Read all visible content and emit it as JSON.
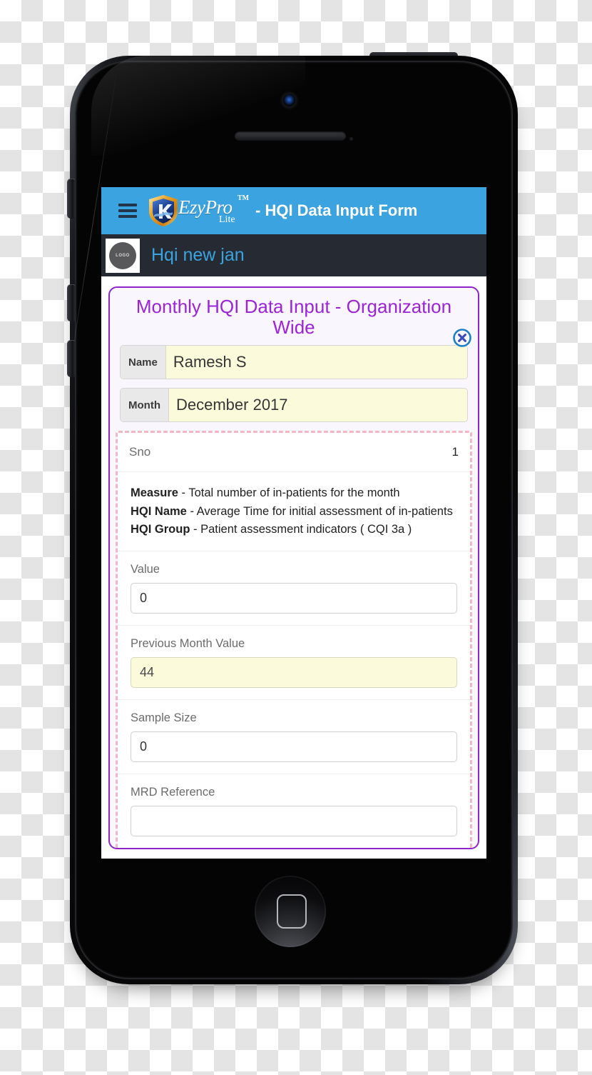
{
  "app": {
    "header": {
      "menu_icon": "hamburger-menu-icon",
      "brand_name": "EzyPro",
      "brand_tm": "TM",
      "brand_edition": "Lite",
      "title": "- HQI Data Input Form",
      "background_color": "#3ba3e0"
    },
    "sub_header": {
      "logo_text": "LOGO",
      "org_name": "Hqi new jan",
      "background_color": "#262a33",
      "org_name_color": "#3ba3e0"
    }
  },
  "form": {
    "title": "Monthly HQI Data Input - Organization Wide",
    "title_color": "#9b23d8",
    "border_color": "#8e24c9",
    "close_icon": "close-circle-icon",
    "fields": [
      {
        "label": "Name",
        "value": "Ramesh S"
      },
      {
        "label": "Month",
        "value": "December 2017"
      }
    ],
    "record": {
      "sno_label": "Sno",
      "sno_value": "1",
      "measure_label": "Measure",
      "measure_text": "- Total number of in-patients for the month",
      "hqi_name_label": "HQI Name",
      "hqi_name_text": "- Average Time for initial assessment of in-patients",
      "hqi_group_label": "HQI Group",
      "hqi_group_text": "- Patient assessment indicators ( CQI 3a )",
      "inputs": [
        {
          "label": "Value",
          "value": "0",
          "readonly": false
        },
        {
          "label": "Previous Month Value",
          "value": "44",
          "readonly": true
        },
        {
          "label": "Sample Size",
          "value": "0",
          "readonly": false
        },
        {
          "label": "MRD Reference",
          "value": "",
          "readonly": false
        }
      ]
    }
  },
  "device": {
    "type": "smartphone",
    "home_button": "home-button",
    "camera": "front-camera",
    "speaker": "earpiece-speaker"
  }
}
